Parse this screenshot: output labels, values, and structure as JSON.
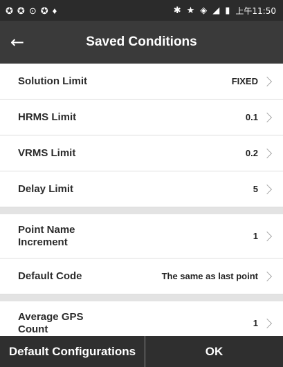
{
  "status_bar": {
    "left_icons": [
      "notification-icon",
      "notification-icon",
      "sync-icon",
      "notification-icon",
      "location-pin-icon"
    ],
    "right_icons": [
      "bluetooth-icon",
      "star-icon",
      "wifi-icon",
      "signal-icon",
      "battery-icon"
    ],
    "time": "上午11:50"
  },
  "app_bar": {
    "back_glyph": "←",
    "title": "Saved Conditions"
  },
  "rows": [
    {
      "label": "Solution Limit",
      "value": "FIXED"
    },
    {
      "label": "HRMS Limit",
      "value": "0.1"
    },
    {
      "label": "VRMS Limit",
      "value": "0.2"
    },
    {
      "label": "Delay Limit",
      "value": "5"
    },
    {
      "label": "Point Name Increment",
      "value": "1"
    },
    {
      "label": "Default Code",
      "value": "The same as last point"
    },
    {
      "label": "Average GPS Count",
      "value": "1"
    }
  ],
  "bottom": {
    "default_configurations": "Default Configurations",
    "ok": "OK"
  },
  "colors": {
    "app_bar": "#3a3a3a",
    "status_bar": "#2b2b2b",
    "bottom_bar": "#2f2f2f",
    "row_background": "#ffffff",
    "section_gap": "#e3e3e3"
  }
}
